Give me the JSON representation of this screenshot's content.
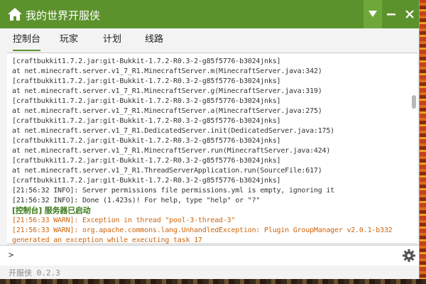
{
  "app": {
    "title": "我的世界开服侠",
    "accent": "#5c922c"
  },
  "tabs": [
    {
      "label": "控制台",
      "active": true
    },
    {
      "label": "玩家",
      "active": false
    },
    {
      "label": "计划",
      "active": false
    },
    {
      "label": "线路",
      "active": false
    }
  ],
  "console": {
    "lines": [
      {
        "text": "[craftbukkit1.7.2.jar:git-Bukkit-1.7.2-R0.3-2-g85f5776-b3024jnks]",
        "kind": "normal"
      },
      {
        "text": "at net.minecraft.server.v1_7_R1.MinecraftServer.m(MinecraftServer.java:342)",
        "kind": "normal"
      },
      {
        "text": "[craftbukkit1.7.2.jar:git-Bukkit-1.7.2-R0.3-2-g85f5776-b3024jnks]",
        "kind": "normal"
      },
      {
        "text": "at net.minecraft.server.v1_7_R1.MinecraftServer.g(MinecraftServer.java:319)",
        "kind": "normal"
      },
      {
        "text": "[craftbukkit1.7.2.jar:git-Bukkit-1.7.2-R0.3-2-g85f5776-b3024jnks]",
        "kind": "normal"
      },
      {
        "text": "at net.minecraft.server.v1_7_R1.MinecraftServer.a(MinecraftServer.java:275)",
        "kind": "normal"
      },
      {
        "text": "[craftbukkit1.7.2.jar:git-Bukkit-1.7.2-R0.3-2-g85f5776-b3024jnks]",
        "kind": "normal"
      },
      {
        "text": "at net.minecraft.server.v1_7_R1.DedicatedServer.init(DedicatedServer.java:175)",
        "kind": "normal"
      },
      {
        "text": "[craftbukkit1.7.2.jar:git-Bukkit-1.7.2-R0.3-2-g85f5776-b3024jnks]",
        "kind": "normal"
      },
      {
        "text": "at net.minecraft.server.v1_7_R1.MinecraftServer.run(MinecraftServer.java:424)",
        "kind": "normal"
      },
      {
        "text": "[craftbukkit1.7.2.jar:git-Bukkit-1.7.2-R0.3-2-g85f5776-b3024jnks]",
        "kind": "normal"
      },
      {
        "text": "at net.minecraft.server.v1_7_R1.ThreadServerApplication.run(SourceFile:617)",
        "kind": "normal"
      },
      {
        "text": "[craftbukkit1.7.2.jar:git-Bukkit-1.7.2-R0.3-2-g85f5776-b3024jnks]",
        "kind": "normal"
      },
      {
        "text": "[21:56:32 INFO]: Server permissions file permissions.yml is empty, ignoring it",
        "kind": "normal"
      },
      {
        "text": "[21:56:32 INFO]: Done (1.423s)! For help, type \"help\" or \"?\"",
        "kind": "normal"
      },
      {
        "text": "[控制台] 服务器已启动",
        "kind": "ok"
      },
      {
        "text": "[21:56:33 WARN]: Exception in thread \"pool-3-thread-3\"",
        "kind": "warn"
      },
      {
        "text": "[21:56:33 WARN]: org.apache.commons.lang.UnhandledException: Plugin GroupManager v2.0.1-b332",
        "kind": "warn"
      },
      {
        "text": "generated an exception while executing task 17",
        "kind": "warn"
      }
    ],
    "colors": {
      "normal": "#333333",
      "warn": "#cc6611",
      "ok": "#3a7a18"
    }
  },
  "input": {
    "prompt": ">",
    "value": "",
    "placeholder": ""
  },
  "status": {
    "text": "开服侠 0.2.3"
  },
  "icons": {
    "home": "home-icon",
    "menu": "triangle-down-icon",
    "minimize": "minimize-icon",
    "close": "close-icon",
    "settings": "gear-icon"
  }
}
